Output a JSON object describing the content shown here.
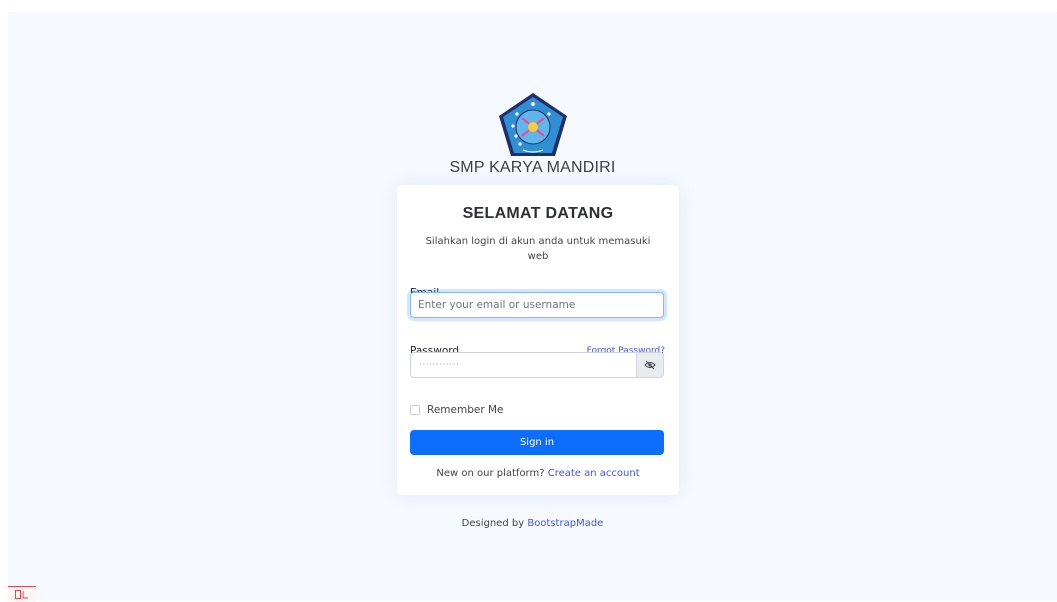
{
  "school": {
    "name": "SMP KARYA MANDIRI",
    "logo_icon": "school-emblem-icon"
  },
  "login": {
    "title": "SELAMAT DATANG",
    "subtitle": "Silahkan login di akun anda untuk memasuki web",
    "email_label": "Email",
    "email_placeholder": "Enter your email or username",
    "password_label": "Password",
    "forgot_password": "Forgot Password?",
    "password_placeholder": "············",
    "toggle_icon": "eye-slash-icon",
    "remember_label": "Remember Me",
    "signin_label": "Sign in",
    "register_prompt": "New on our platform?",
    "register_link": "Create an account"
  },
  "footer": {
    "designed_by": "Designed by",
    "credit_link": "BootstrapMade"
  },
  "colors": {
    "page_bg": "#f6f9ff",
    "primary": "#0d6efd",
    "link": "#4154f1",
    "logo_blue": "#2f8fd2",
    "logo_navy": "#1e2f6b"
  }
}
